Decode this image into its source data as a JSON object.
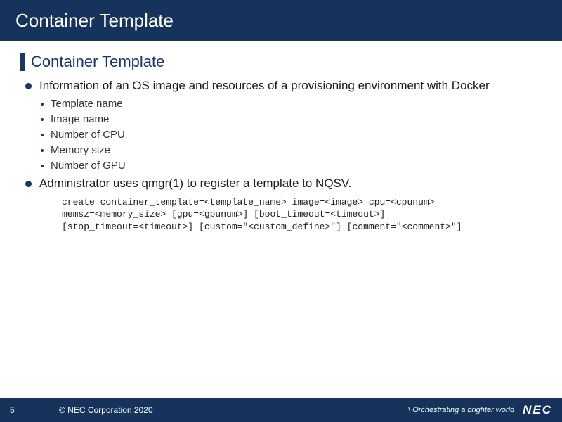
{
  "title": "Container Template",
  "section_heading": "Container Template",
  "items": [
    {
      "level": 1,
      "text": "Information of an OS image and resources of a provisioning environment with Docker"
    },
    {
      "level": 2,
      "text": "Template name"
    },
    {
      "level": 2,
      "text": "Image name"
    },
    {
      "level": 2,
      "text": "Number of CPU"
    },
    {
      "level": 2,
      "text": "Memory size"
    },
    {
      "level": 2,
      "text": "Number of GPU"
    },
    {
      "level": 1,
      "text": "Administrator uses qmgr(1) to register a template to NQSV."
    }
  ],
  "code": "create container_template=<template_name> image=<image> cpu=<cpunum>\nmemsz=<memory_size> [gpu=<gpunum>] [boot_timeout=<timeout>]\n[stop_timeout=<timeout>] [custom=\"<custom_define>\"] [comment=\"<comment>\"]",
  "footer": {
    "page": "5",
    "copyright": "© NEC Corporation 2020",
    "tagline": "Orchestrating a brighter world",
    "logo": "NEC"
  }
}
